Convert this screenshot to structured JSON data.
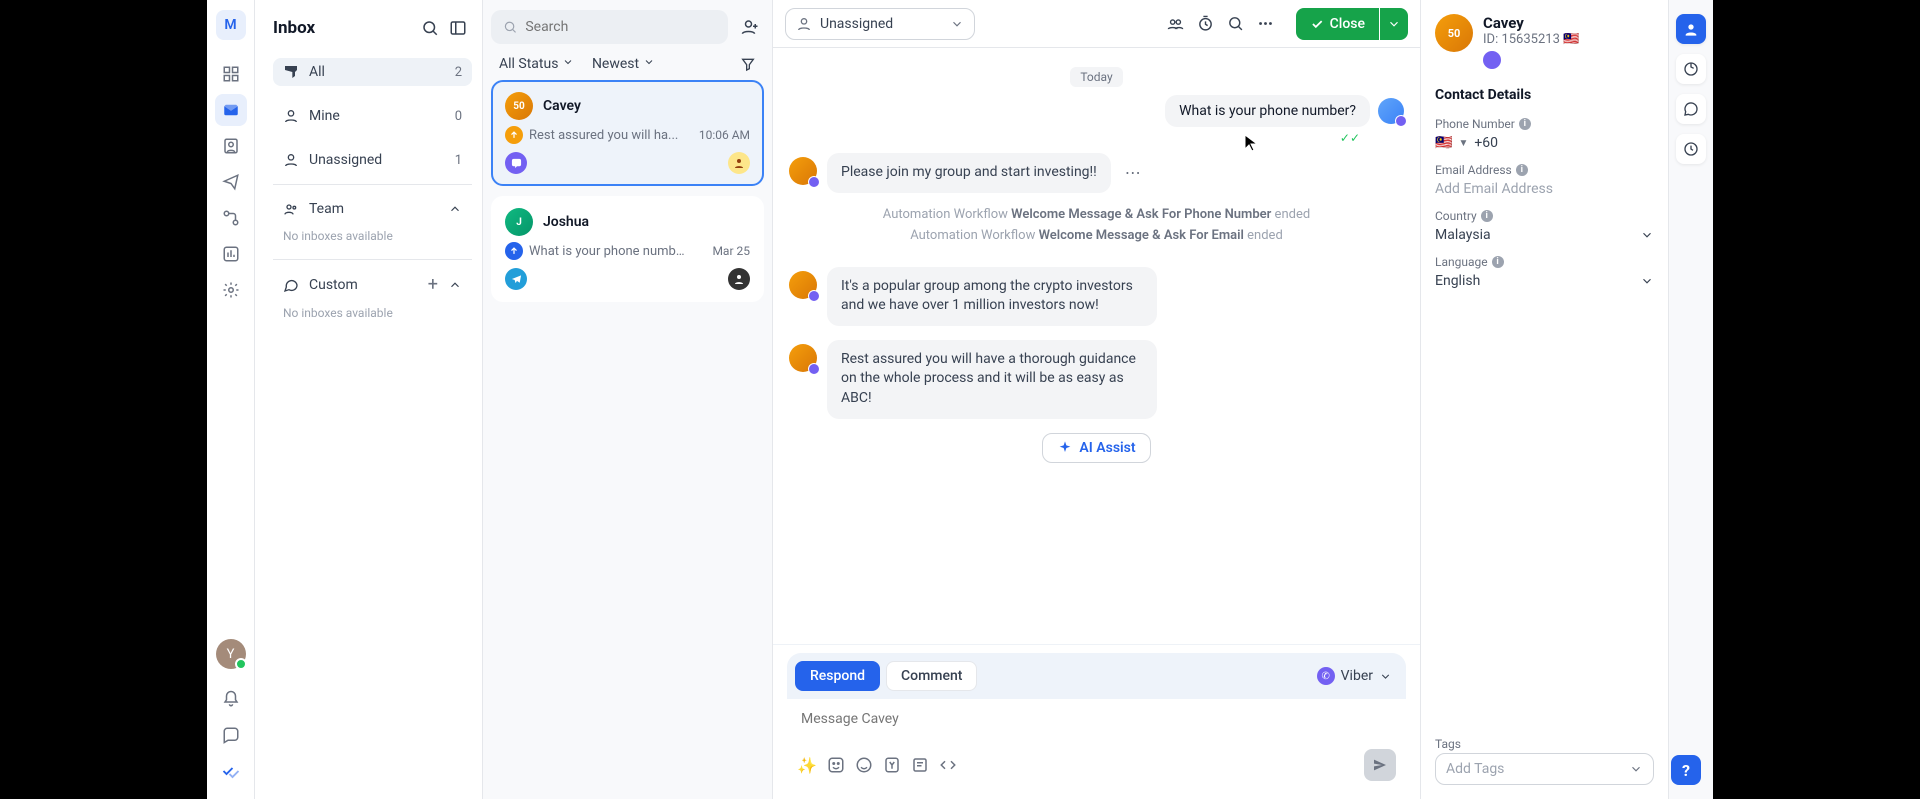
{
  "workspace_initial": "M",
  "inbox": {
    "title": "Inbox",
    "filters": {
      "all": {
        "label": "All",
        "count": "2"
      },
      "mine": {
        "label": "Mine",
        "count": "0"
      },
      "unassigned": {
        "label": "Unassigned",
        "count": "1"
      }
    },
    "team": {
      "label": "Team"
    },
    "custom": {
      "label": "Custom"
    },
    "none_label": "No inboxes available"
  },
  "convo_list": {
    "search_placeholder": "Search",
    "status_label": "All Status",
    "sort_label": "Newest",
    "items": [
      {
        "name": "Cavey",
        "preview": "Rest assured you will ha...",
        "time": "10:06 AM",
        "channel": "viber",
        "selected": true
      },
      {
        "name": "Joshua",
        "preview": "What is your phone number?",
        "time": "Mar 25",
        "channel": "telegram",
        "selected": false
      }
    ]
  },
  "chat": {
    "assignee_label": "Unassigned",
    "close_label": "Close",
    "day_sep": "Today",
    "out1": "What is your phone number?",
    "in1": "Please join my group and start investing!!",
    "sys1_pre": "Automation Workflow ",
    "sys1_name": "Welcome Message & Ask For Phone Number",
    "sys1_end": " ended",
    "sys2_pre": "Automation Workflow ",
    "sys2_name": "Welcome Message & Ask For Email",
    "sys2_end": " ended",
    "in2": "It's a popular group among the crypto investors and we have over 1 million investors now!",
    "in3": "Rest assured you will have a thorough guidance on the whole process and it will be as easy as ABC!",
    "ai_assist": "AI Assist",
    "compose_tabs": {
      "respond": "Respond",
      "comment": "Comment"
    },
    "channel": "Viber",
    "msg_placeholder": "Message Cavey"
  },
  "contact": {
    "name": "Cavey",
    "id_label": "ID: 15635213",
    "flag": "🇲🇾",
    "section": "Contact Details",
    "phone_label": "Phone Number",
    "phone_flag": "🇲🇾",
    "phone_value": "+60",
    "email_label": "Email Address",
    "email_placeholder": "Add Email Address",
    "country_label": "Country",
    "country_value": "Malaysia",
    "lang_label": "Language",
    "lang_value": "English",
    "tags_label": "Tags",
    "tags_placeholder": "Add Tags"
  },
  "me_avatar": "Y"
}
